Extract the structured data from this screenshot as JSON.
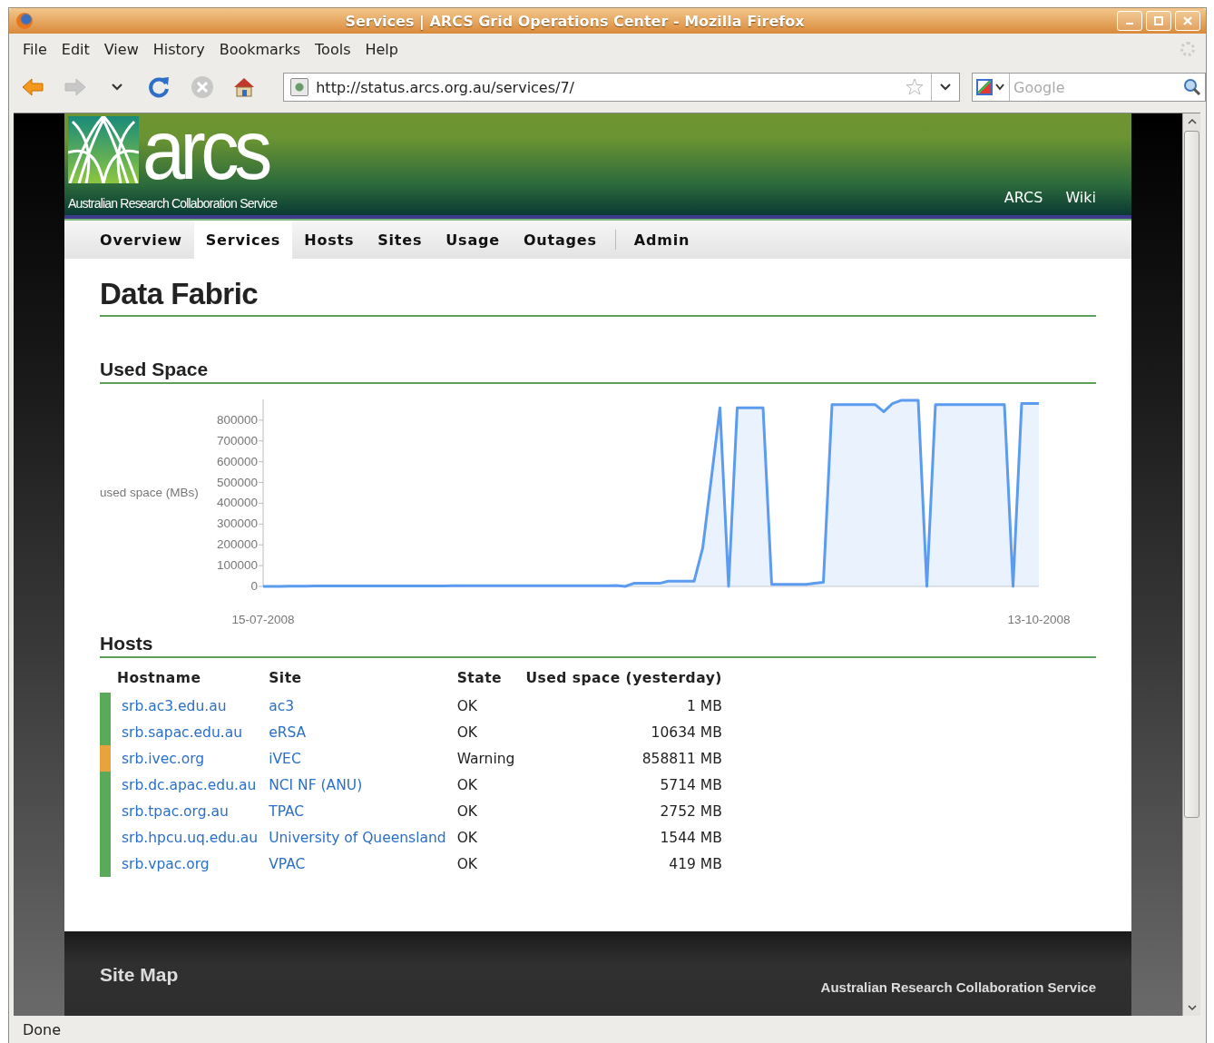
{
  "window": {
    "title": "Services | ARCS Grid Operations Center - Mozilla Firefox"
  },
  "menu": [
    "File",
    "Edit",
    "View",
    "History",
    "Bookmarks",
    "Tools",
    "Help"
  ],
  "toolbar": {
    "buttons": [
      {
        "kind": "back",
        "disabled": false
      },
      {
        "kind": "forward",
        "disabled": true
      },
      {
        "kind": "history",
        "disabled": false
      },
      {
        "kind": "reload",
        "disabled": false
      },
      {
        "kind": "stop",
        "disabled": true
      },
      {
        "kind": "home",
        "disabled": false
      }
    ],
    "url": "http://status.arcs.org.au/services/7/",
    "search": {
      "placeholder": "Google"
    }
  },
  "site": {
    "logo": "arcs",
    "tagline": "Australian Research Collaboration Service",
    "header_links": [
      "ARCS",
      "Wiki"
    ],
    "nav": [
      {
        "label": "Overview",
        "selected": false,
        "separator_before": false
      },
      {
        "label": "Services",
        "selected": true,
        "separator_before": false
      },
      {
        "label": "Hosts",
        "selected": false,
        "separator_before": false
      },
      {
        "label": "Sites",
        "selected": false,
        "separator_before": false
      },
      {
        "label": "Usage",
        "selected": false,
        "separator_before": false
      },
      {
        "label": "Outages",
        "selected": false,
        "separator_before": false
      },
      {
        "label": "Admin",
        "selected": false,
        "separator_before": true
      }
    ]
  },
  "page_title": "Data Fabric",
  "used_space": {
    "heading": "Used Space",
    "chart_data": {
      "type": "area",
      "ylabel": "used space (MBs)",
      "categories": [
        "15-07-2008",
        null,
        null,
        null,
        null,
        null,
        null,
        null,
        null,
        null,
        null,
        null,
        null,
        null,
        null,
        null,
        null,
        null,
        null,
        null,
        null,
        null,
        null,
        null,
        null,
        null,
        null,
        null,
        null,
        null,
        null,
        null,
        null,
        null,
        null,
        null,
        null,
        null,
        null,
        null,
        null,
        null,
        null,
        null,
        null,
        null,
        null,
        null,
        null,
        null,
        null,
        null,
        null,
        null,
        null,
        null,
        null,
        null,
        null,
        null,
        null,
        null,
        null,
        null,
        null,
        null,
        null,
        null,
        null,
        null,
        null,
        null,
        null,
        null,
        null,
        null,
        null,
        null,
        null,
        null,
        null,
        null,
        null,
        null,
        null,
        null,
        null,
        null,
        null,
        null,
        "13-10-2008"
      ],
      "series": [
        {
          "color": "#5b9bf0",
          "values": [
            0,
            300,
            600,
            900,
            1200,
            1500,
            1800,
            2000,
            2000,
            2000,
            2000,
            2000,
            2000,
            2000,
            2000,
            2000,
            2000,
            2000,
            2000,
            2000,
            2000,
            2000,
            3000,
            3000,
            3000,
            3000,
            3000,
            3000,
            3000,
            3000,
            3000,
            3000,
            3000,
            3000,
            3000,
            3000,
            3000,
            3000,
            3000,
            3000,
            3000,
            4000,
            0,
            15000,
            15000,
            15000,
            15000,
            25000,
            25000,
            25000,
            25000,
            185000,
            520000,
            860000,
            0,
            860000,
            860000,
            860000,
            860000,
            10000,
            10000,
            10000,
            10000,
            10000,
            15000,
            20000,
            875000,
            875000,
            875000,
            875000,
            875000,
            875000,
            840000,
            880000,
            895000,
            895000,
            895000,
            0,
            875000,
            875000,
            875000,
            875000,
            875000,
            875000,
            875000,
            875000,
            875000,
            0,
            880000,
            880000,
            880000
          ]
        }
      ],
      "ylim": [
        0,
        900000
      ],
      "yticks": [
        0,
        100000,
        200000,
        300000,
        400000,
        500000,
        600000,
        700000,
        800000
      ]
    }
  },
  "hosts": {
    "heading": "Hosts",
    "columns": [
      "Hostname",
      "Site",
      "State",
      "Used space (yesterday)"
    ],
    "rows": [
      {
        "hostname": "srb.ac3.edu.au",
        "site": "ac3",
        "state": "OK",
        "used": "1 MB",
        "color": "#5aaa5a"
      },
      {
        "hostname": "srb.sapac.edu.au",
        "site": "eRSA",
        "state": "OK",
        "used": "10634 MB",
        "color": "#5aaa5a"
      },
      {
        "hostname": "srb.ivec.org",
        "site": "iVEC",
        "state": "Warning",
        "used": "858811 MB",
        "color": "#e8a33c"
      },
      {
        "hostname": "srb.dc.apac.edu.au",
        "site": "NCI NF (ANU)",
        "state": "OK",
        "used": "5714 MB",
        "color": "#5aaa5a"
      },
      {
        "hostname": "srb.tpac.org.au",
        "site": "TPAC",
        "state": "OK",
        "used": "2752 MB",
        "color": "#5aaa5a"
      },
      {
        "hostname": "srb.hpcu.uq.edu.au",
        "site": "University of Queensland",
        "state": "OK",
        "used": "1544 MB",
        "color": "#5aaa5a"
      },
      {
        "hostname": "srb.vpac.org",
        "site": "VPAC",
        "state": "OK",
        "used": "419 MB",
        "color": "#5aaa5a"
      }
    ]
  },
  "footer": {
    "title": "Site Map",
    "org": "Australian Research Collaboration Service"
  },
  "status_bar": "Done"
}
